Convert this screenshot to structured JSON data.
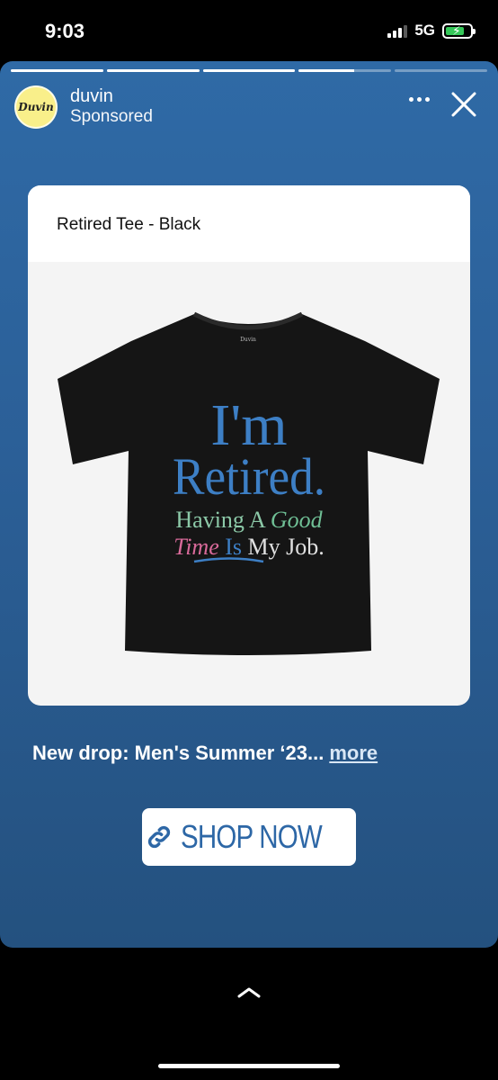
{
  "status_bar": {
    "time": "9:03",
    "network": "5G",
    "battery_level": 0.78
  },
  "story": {
    "progress": [
      1,
      1,
      1,
      0.6,
      0
    ],
    "account": {
      "name": "duvin",
      "label": "Sponsored",
      "avatar_text": "Duvin"
    },
    "product": {
      "title": "Retired Tee - Black",
      "shirt_brand": "Duvin",
      "print_lines": {
        "line1": "I'm",
        "line2": "Retired.",
        "line3a": "Having A ",
        "line3b": "Good",
        "line4a": "Time ",
        "line4b": "Is",
        "line4c": " My Job."
      }
    },
    "caption": {
      "text": "New drop: Men's Summer ‘23...",
      "more": "more"
    },
    "cta": {
      "label": "SHOP NOW"
    }
  },
  "colors": {
    "accent": "#2d67a6",
    "background_top": "#2f6aa6",
    "background_bottom": "#24517f"
  },
  "icons": [
    "more-icon",
    "close-icon",
    "link-icon",
    "chevron-up-icon"
  ]
}
